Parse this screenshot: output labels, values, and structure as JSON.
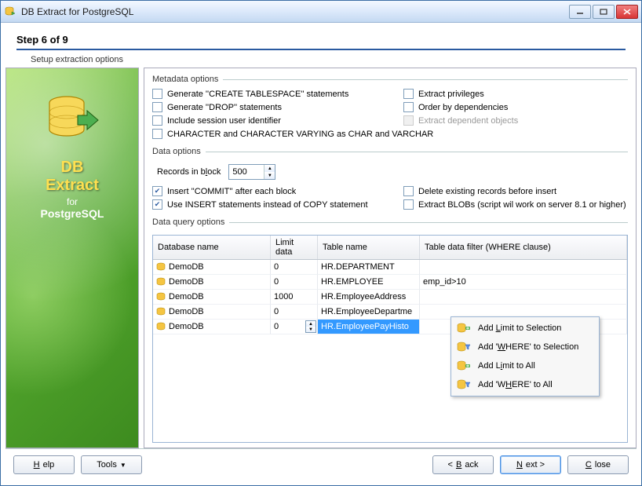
{
  "window": {
    "title": "DB Extract for PostgreSQL"
  },
  "step": {
    "title": "Step 6 of 9",
    "subtitle": "Setup extraction options"
  },
  "sidebar": {
    "line1": "DB",
    "line2": "Extract",
    "line3": "for",
    "line4": "PostgreSQL"
  },
  "metadata": {
    "label": "Metadata options",
    "generate_tablespace": "Generate ''CREATE TABLESPACE'' statements",
    "extract_privileges": "Extract privileges",
    "generate_drop": "Generate ''DROP'' statements",
    "order_by_deps": "Order by dependencies",
    "include_session_uid": "Include session user identifier",
    "extract_dep_objects": "Extract dependent objects",
    "char_varchar": "CHARACTER and CHARACTER VARYING as CHAR and VARCHAR"
  },
  "data": {
    "label": "Data options",
    "records_in_block": "Records in block",
    "records_value": "500",
    "insert_commit": "Insert ''COMMIT'' after each block",
    "delete_existing": "Delete existing records before insert",
    "use_insert": "Use INSERT statements instead of COPY statement",
    "extract_blobs": "Extract BLOBs (script wil work on server 8.1 or higher)"
  },
  "query": {
    "label": "Data query options",
    "columns": {
      "db": "Database name",
      "limit": "Limit data",
      "table": "Table name",
      "where": "Table data filter (WHERE clause)"
    },
    "rows": [
      {
        "db": "DemoDB",
        "limit": "0",
        "table": "HR.DEPARTMENT",
        "where": ""
      },
      {
        "db": "DemoDB",
        "limit": "0",
        "table": "HR.EMPLOYEE",
        "where": "emp_id>10"
      },
      {
        "db": "DemoDB",
        "limit": "1000",
        "table": "HR.EmployeeAddress",
        "where": ""
      },
      {
        "db": "DemoDB",
        "limit": "0",
        "table": "HR.EmployeeDepartme",
        "where": ""
      },
      {
        "db": "DemoDB",
        "limit": "0",
        "table": "HR.EmployeePayHisto",
        "where": "",
        "selected": true
      }
    ]
  },
  "context_menu": {
    "add_limit_sel": "Add Limit to Selection",
    "add_where_sel": "Add 'WHERE' to Selection",
    "add_limit_all": "Add Limit to All",
    "add_where_all": "Add 'WHERE' to All"
  },
  "footer": {
    "help": "Help",
    "tools": "Tools",
    "back": "< Back",
    "next": "Next >",
    "close": "Close"
  },
  "colors": {
    "accent": "#2a5aa0",
    "selection": "#3399ff"
  }
}
